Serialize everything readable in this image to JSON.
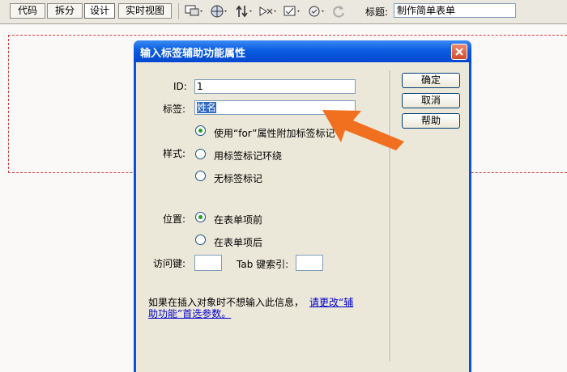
{
  "toolbar": {
    "view_buttons": [
      "代码",
      "拆分",
      "设计",
      "实时视图"
    ],
    "active_view": "设计",
    "icons": [
      "multiscreen-icon",
      "globe-icon",
      "file-transfer-icon",
      "preview-icon",
      "visual-aids-icon",
      "validate-icon",
      "refresh-icon"
    ],
    "title_label": "标题:",
    "title_value": "制作简单表单"
  },
  "dialog": {
    "title": "输入标签辅助功能属性",
    "id_label": "ID:",
    "id_value": "1",
    "label_label": "标签:",
    "label_value": "姓名",
    "style_label": "样式:",
    "style_options": [
      "使用“for”属性附加标签标记",
      "用标签标记环绕",
      "无标签标记"
    ],
    "style_selected": 0,
    "position_label": "位置:",
    "position_options": [
      "在表单项前",
      "在表单项后"
    ],
    "position_selected": 0,
    "access_key_label": "访问键:",
    "access_key_value": "",
    "tab_index_label": "Tab 键索引:",
    "tab_index_value": "",
    "info_text": "如果在插入对象时不想输入此信息，",
    "info_link_line1": "请更改“辅",
    "info_link_line2": "助功能”首选参数。",
    "buttons": {
      "ok": "确定",
      "cancel": "取消",
      "help": "帮助"
    }
  },
  "colors": {
    "annotation_arrow": "#f07020",
    "titlebar_blue": "#0a5ce0",
    "dialog_bg": "#ece8d9"
  }
}
